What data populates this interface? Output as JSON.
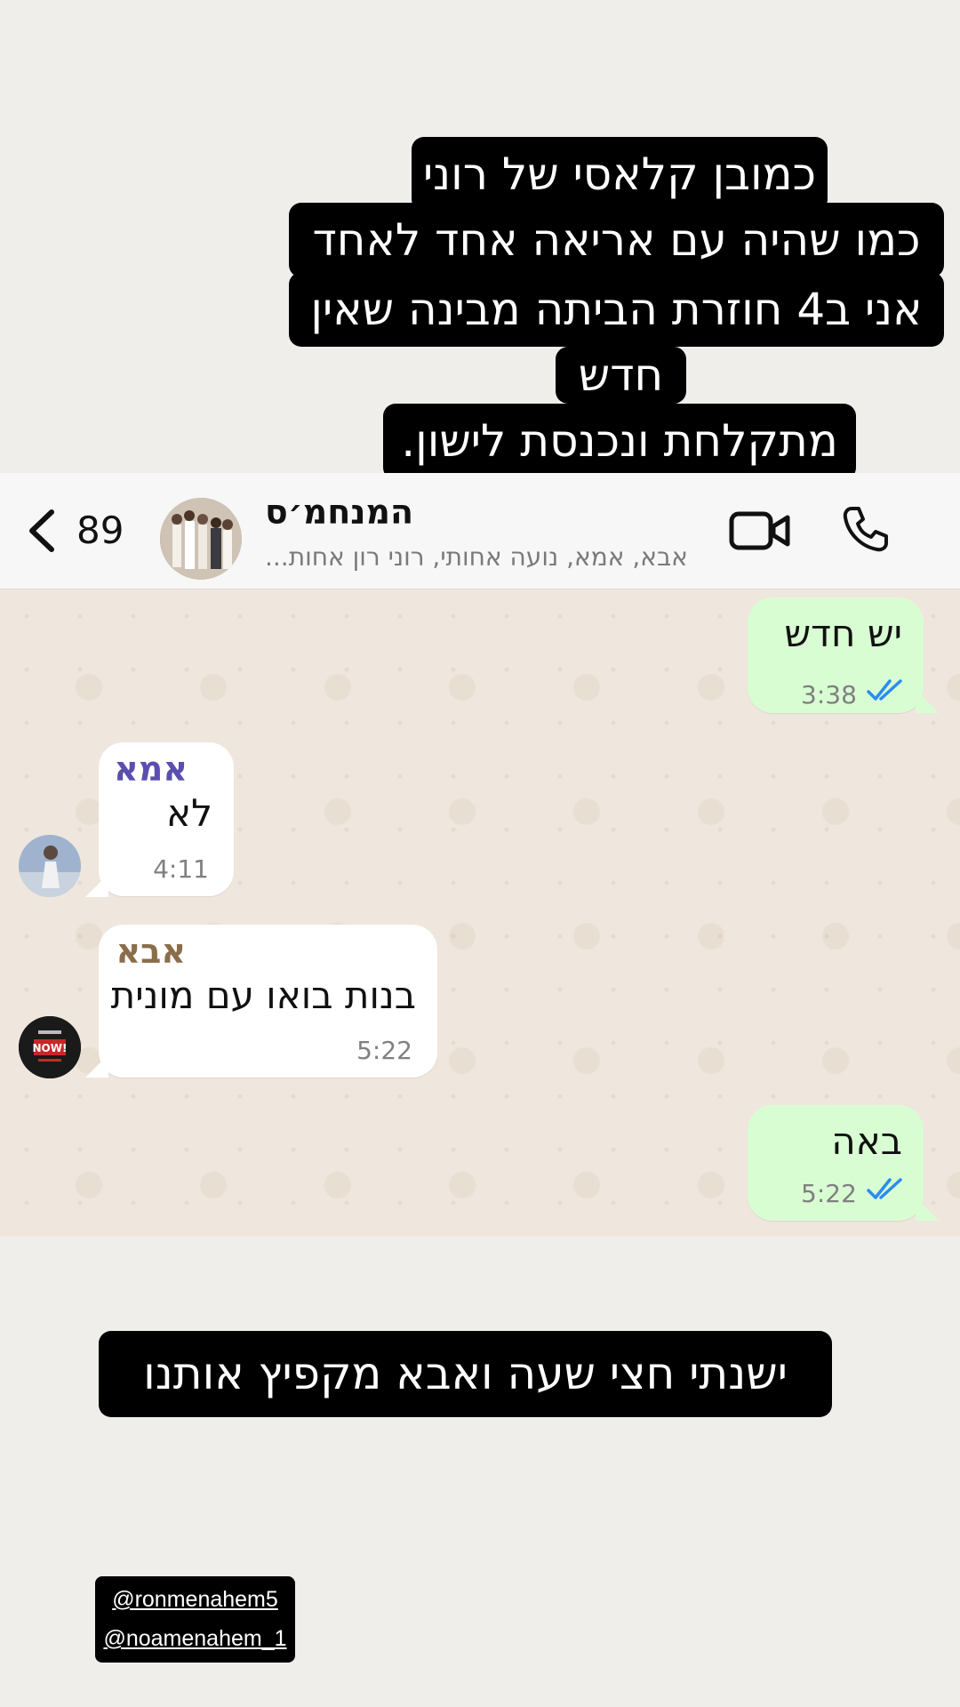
{
  "story_caption": {
    "lines": [
      "כמובן קלאסי של רוני",
      "כמו שהיה עם אריאה אחד לאחד",
      "אני ב4 חוזרת הביתה מבינה שאין",
      "חדש",
      "מתקלחת ונכנסת לישון."
    ]
  },
  "header": {
    "unread_count": "89",
    "group_name": "המנחמ׳ס",
    "participants": "אבא, אמא, נועה אחותי, רוני רון אחות...",
    "icons": [
      "chevron-left-icon",
      "video-call-icon",
      "phone-call-icon"
    ]
  },
  "messages": [
    {
      "direction": "outgoing",
      "text": "יש חדש",
      "time": "3:38",
      "status": "read"
    },
    {
      "direction": "incoming",
      "sender": "אמא",
      "sender_color": "#5a4fb0",
      "text": "לא",
      "time": "4:11"
    },
    {
      "direction": "incoming",
      "sender": "אבא",
      "sender_color": "#8a6d4a",
      "text": "בנות בואו עם מונית",
      "time": "5:22",
      "avatar_text": "NOW!"
    },
    {
      "direction": "outgoing",
      "text": "באה",
      "time": "5:22",
      "status": "read"
    }
  ],
  "bottom_caption": "ישנתי חצי שעה  ואבא מקפיץ אותנו",
  "mentions": [
    "@ronmenahem5",
    "@noamenahem_1"
  ],
  "colors": {
    "outgoing_bubble": "#d9fdd3",
    "incoming_bubble": "#ffffff",
    "read_ticks": "#2b8cf0",
    "caption_bg": "#000000"
  }
}
